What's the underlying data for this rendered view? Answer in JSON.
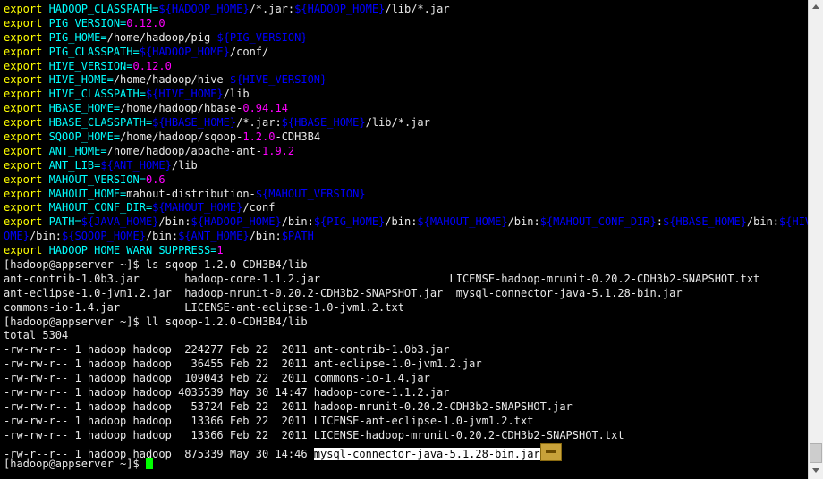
{
  "terminal": {
    "lines": [
      [
        [
          "kw",
          "export "
        ],
        [
          "var",
          "HADOOP_CLASSPATH="
        ],
        [
          "ref",
          "${HADOOP_HOME}"
        ],
        [
          "plain",
          "/*.jar:"
        ],
        [
          "ref",
          "${HADOOP_HOME}"
        ],
        [
          "plain",
          "/lib/*.jar"
        ]
      ],
      [
        [
          "kw",
          "export "
        ],
        [
          "var",
          "PIG_VERSION="
        ],
        [
          "num",
          "0.12.0"
        ]
      ],
      [
        [
          "kw",
          "export "
        ],
        [
          "var",
          "PIG_HOME="
        ],
        [
          "plain",
          "/home/hadoop/pig-"
        ],
        [
          "ref",
          "${PIG_VERSION}"
        ]
      ],
      [
        [
          "kw",
          "export "
        ],
        [
          "var",
          "PIG_CLASSPATH="
        ],
        [
          "ref",
          "${HADOOP_HOME}"
        ],
        [
          "plain",
          "/conf/"
        ]
      ],
      [
        [
          "kw",
          "export "
        ],
        [
          "var",
          "HIVE_VERSION="
        ],
        [
          "num",
          "0.12.0"
        ]
      ],
      [
        [
          "kw",
          "export "
        ],
        [
          "var",
          "HIVE_HOME="
        ],
        [
          "plain",
          "/home/hadoop/hive-"
        ],
        [
          "ref",
          "${HIVE_VERSION}"
        ]
      ],
      [
        [
          "kw",
          "export "
        ],
        [
          "var",
          "HIVE_CLASSPATH="
        ],
        [
          "ref",
          "${HIVE_HOME}"
        ],
        [
          "plain",
          "/lib"
        ]
      ],
      [
        [
          "kw",
          "export "
        ],
        [
          "var",
          "HBASE_HOME="
        ],
        [
          "plain",
          "/home/hadoop/hbase-"
        ],
        [
          "num",
          "0.94.14"
        ]
      ],
      [
        [
          "kw",
          "export "
        ],
        [
          "var",
          "HBASE_CLASSPATH="
        ],
        [
          "ref",
          "${HBASE_HOME}"
        ],
        [
          "plain",
          "/*.jar:"
        ],
        [
          "ref",
          "${HBASE_HOME}"
        ],
        [
          "plain",
          "/lib/*.jar"
        ]
      ],
      [
        [
          "kw",
          "export "
        ],
        [
          "var",
          "SQOOP_HOME="
        ],
        [
          "plain",
          "/home/hadoop/sqoop-"
        ],
        [
          "num",
          "1.2.0"
        ],
        [
          "plain",
          "-CDH3B4"
        ]
      ],
      [
        [
          "kw",
          "export "
        ],
        [
          "var",
          "ANT_HOME="
        ],
        [
          "plain",
          "/home/hadoop/apache-ant-"
        ],
        [
          "num",
          "1.9.2"
        ]
      ],
      [
        [
          "kw",
          "export "
        ],
        [
          "var",
          "ANT_LIB="
        ],
        [
          "ref",
          "${ANT_HOME}"
        ],
        [
          "plain",
          "/lib"
        ]
      ],
      [
        [
          "kw",
          "export "
        ],
        [
          "var",
          "MAHOUT_VERSION="
        ],
        [
          "num",
          "0.6"
        ]
      ],
      [
        [
          "kw",
          "export "
        ],
        [
          "var",
          "MAHOUT_HOME="
        ],
        [
          "plain",
          "mahout-distribution-"
        ],
        [
          "ref",
          "${MAHOUT_VERSION}"
        ]
      ],
      [
        [
          "kw",
          "export "
        ],
        [
          "var",
          "MAHOUT_CONF_DIR="
        ],
        [
          "ref",
          "${MAHOUT_HOME}"
        ],
        [
          "plain",
          "/conf"
        ]
      ],
      [
        [
          "kw",
          "export "
        ],
        [
          "var",
          "PATH="
        ],
        [
          "ref",
          "${JAVA_HOME}"
        ],
        [
          "plain",
          "/bin:"
        ],
        [
          "ref",
          "${HADOOP_HOME}"
        ],
        [
          "plain",
          "/bin:"
        ],
        [
          "ref",
          "${PIG_HOME}"
        ],
        [
          "plain",
          "/bin:"
        ],
        [
          "ref",
          "${MAHOUT_HOME}"
        ],
        [
          "plain",
          "/bin:"
        ],
        [
          "ref",
          "${MAHOUT_CONF_DIR}"
        ],
        [
          "plain",
          ":"
        ],
        [
          "ref",
          "${HBASE_HOME}"
        ],
        [
          "plain",
          "/bin:"
        ],
        [
          "ref",
          "${HIVE_H"
        ]
      ],
      [
        [
          "ref",
          "OME}"
        ],
        [
          "plain",
          "/bin:"
        ],
        [
          "ref",
          "${SQOOP_HOME}"
        ],
        [
          "plain",
          "/bin:"
        ],
        [
          "ref",
          "${ANT_HOME}"
        ],
        [
          "plain",
          "/bin:"
        ],
        [
          "ref",
          "$PATH"
        ]
      ],
      [
        [
          "kw",
          "export "
        ],
        [
          "var",
          "HADOOP_HOME_WARN_SUPPRESS="
        ],
        [
          "num",
          "1"
        ]
      ],
      [
        [
          "plain",
          "[hadoop@appserver ~]$ ls sqoop-1.2.0-CDH3B4/lib"
        ]
      ],
      [
        [
          "plain",
          "ant-contrib-1.0b3.jar       hadoop-core-1.1.2.jar                    LICENSE-hadoop-mrunit-0.20.2-CDH3b2-SNAPSHOT.txt"
        ]
      ],
      [
        [
          "plain",
          "ant-eclipse-1.0-jvm1.2.jar  hadoop-mrunit-0.20.2-CDH3b2-SNAPSHOT.jar  mysql-connector-java-5.1.28-bin.jar"
        ]
      ],
      [
        [
          "plain",
          "commons-io-1.4.jar          LICENSE-ant-eclipse-1.0-jvm1.2.txt"
        ]
      ],
      [
        [
          "plain",
          "[hadoop@appserver ~]$ ll sqoop-1.2.0-CDH3B4/lib"
        ]
      ],
      [
        [
          "plain",
          "total 5304"
        ]
      ],
      [
        [
          "plain",
          "-rw-rw-r-- 1 hadoop hadoop  224277 Feb 22  2011 ant-contrib-1.0b3.jar"
        ]
      ],
      [
        [
          "plain",
          "-rw-rw-r-- 1 hadoop hadoop   36455 Feb 22  2011 ant-eclipse-1.0-jvm1.2.jar"
        ]
      ],
      [
        [
          "plain",
          "-rw-rw-r-- 1 hadoop hadoop  109043 Feb 22  2011 commons-io-1.4.jar"
        ]
      ],
      [
        [
          "plain",
          "-rw-rw-r-- 1 hadoop hadoop 4035539 May 30 14:47 hadoop-core-1.1.2.jar"
        ]
      ],
      [
        [
          "plain",
          "-rw-rw-r-- 1 hadoop hadoop   53724 Feb 22  2011 hadoop-mrunit-0.20.2-CDH3b2-SNAPSHOT.jar"
        ]
      ],
      [
        [
          "plain",
          "-rw-rw-r-- 1 hadoop hadoop   13366 Feb 22  2011 LICENSE-ant-eclipse-1.0-jvm1.2.txt"
        ]
      ],
      [
        [
          "plain",
          "-rw-rw-r-- 1 hadoop hadoop   13366 Feb 22  2011 LICENSE-hadoop-mrunit-0.20.2-CDH3b2-SNAPSHOT.txt"
        ]
      ],
      [
        [
          "plain",
          "-rw-r--r-- 1 hadoop hadoop  875339 May 30 14:46 "
        ],
        [
          "hl",
          "mysql-connector-java-5.1.28-bin.jar"
        ],
        [
          "icon",
          ""
        ]
      ],
      [
        [
          "plain",
          "[hadoop@appserver ~]$ "
        ],
        [
          "cursor",
          ""
        ]
      ]
    ]
  },
  "colors": {
    "background": "#000000",
    "keyword": "#ffff00",
    "variable": "#00ffff",
    "reference": "#0000ff",
    "number": "#ff00ff",
    "text": "#e8e8e8",
    "cursor": "#00ff00"
  },
  "scrollbar": {
    "up_icon": "arrow-up-icon",
    "down_icon": "arrow-down-icon"
  }
}
